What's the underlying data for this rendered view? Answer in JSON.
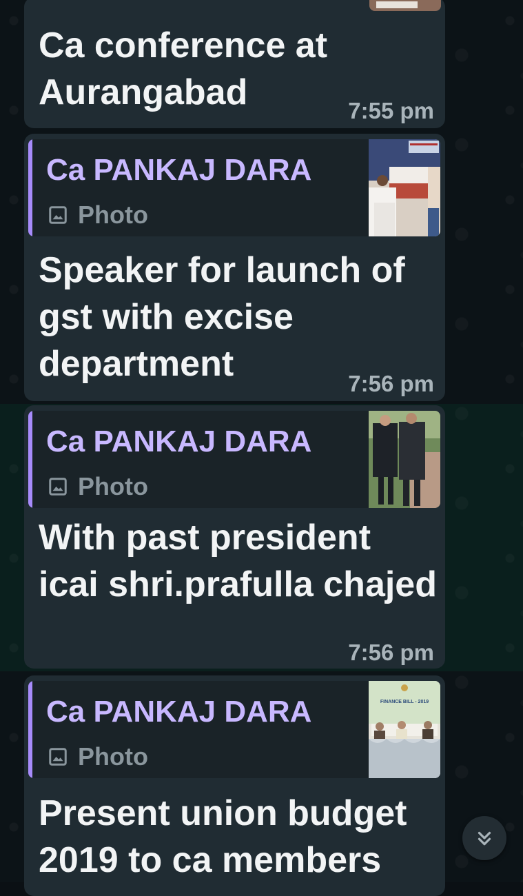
{
  "messages": [
    {
      "text": "Ca conference at Aurangabad",
      "time": "7:55 pm"
    },
    {
      "reply": {
        "sender": "Ca PANKAJ DARA",
        "type_label": "Photo",
        "icon": "photo-icon"
      },
      "text": "Speaker for launch of gst with excise department",
      "time": "7:56 pm"
    },
    {
      "reply": {
        "sender": "Ca PANKAJ DARA",
        "type_label": "Photo",
        "icon": "photo-icon"
      },
      "text": "With past president icai shri.prafulla chajed",
      "time": "7:56 pm"
    },
    {
      "reply": {
        "sender": "Ca PANKAJ DARA",
        "type_label": "Photo",
        "icon": "photo-icon"
      },
      "text": "Present union budget 2019 to ca members",
      "time": ""
    }
  ],
  "thumbnail_texts": {
    "budget_banner": "FINANCE BILL - 2019"
  },
  "colors": {
    "bubble": "#202c33",
    "quote_bar": "#a78bfa",
    "sender_name": "#c8b8ff",
    "highlight": "#0a3a28"
  },
  "scroll_button": {
    "icon": "double-chevron-down-icon"
  }
}
